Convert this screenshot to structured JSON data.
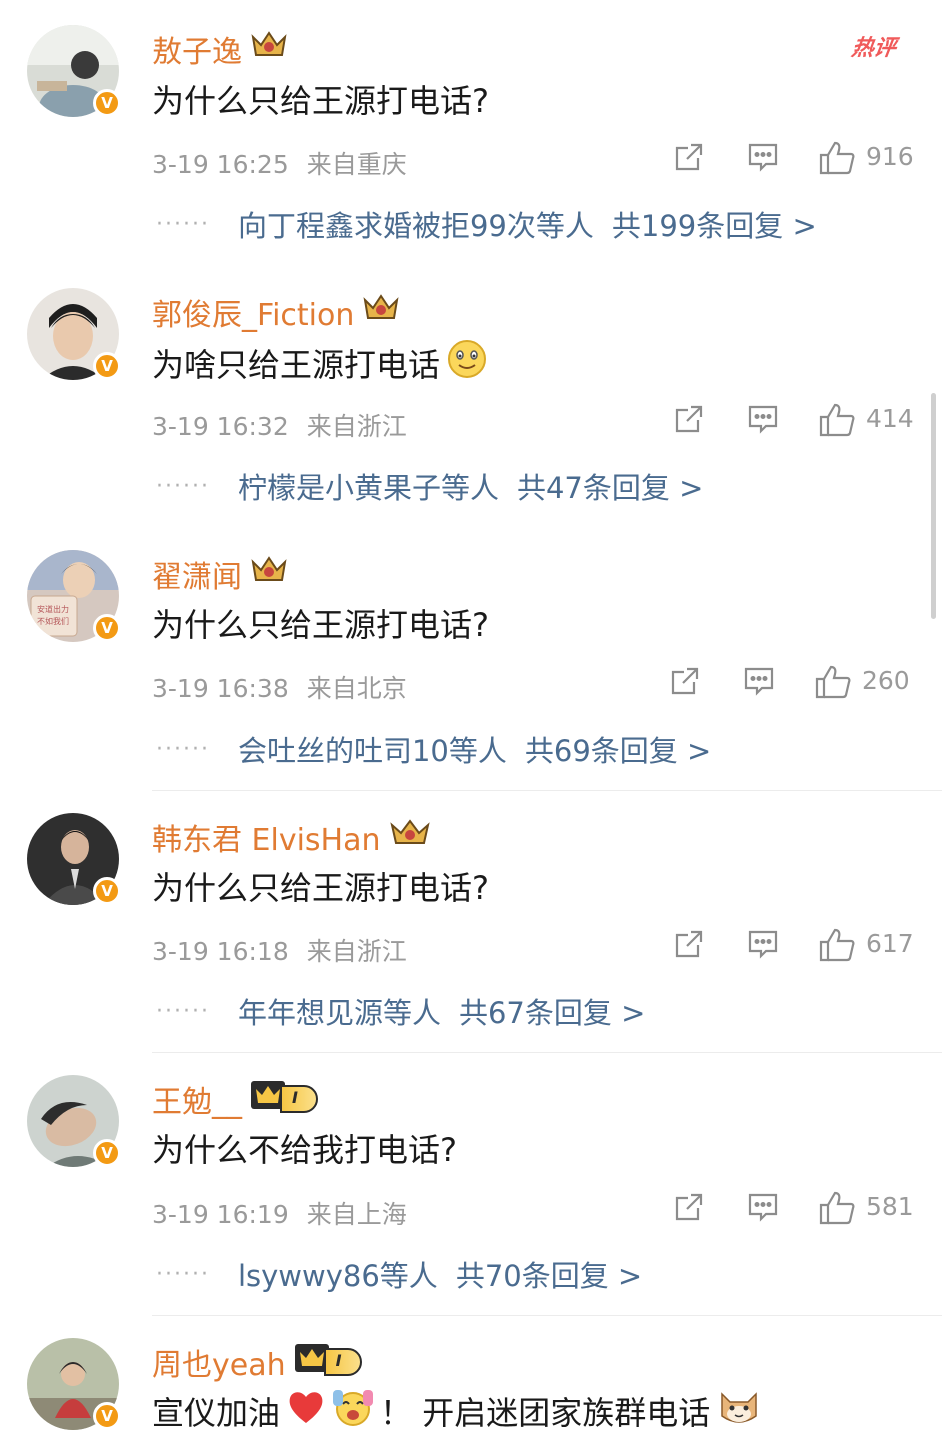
{
  "hot_tag": "热评",
  "comments": [
    {
      "username": "敖子逸",
      "text": "为什么只给王源打电话?",
      "time": "3-19 16:25",
      "location": "来自重庆",
      "likes": "916",
      "reply_users": "向丁程鑫求婚被拒99次等人",
      "reply_count": "共199条回复 >"
    },
    {
      "username": "郭俊辰_Fiction",
      "text": "为啥只给王源打电话",
      "time": "3-19 16:32",
      "location": "来自浙江",
      "likes": "414",
      "reply_users": "柠檬是小黄果子等人",
      "reply_count": "共47条回复 >"
    },
    {
      "username": "翟潇闻",
      "text": "为什么只给王源打电话?",
      "time": "3-19 16:38",
      "location": "来自北京",
      "likes": "260",
      "reply_users": "会吐丝的吐司10等人",
      "reply_count": "共69条回复 >"
    },
    {
      "username": "韩东君 ElvisHan",
      "text": "为什么只给王源打电话?",
      "time": "3-19 16:18",
      "location": "来自浙江",
      "likes": "617",
      "reply_users": "年年想见源等人",
      "reply_count": "共67条回复 >"
    },
    {
      "username": "王勉__",
      "level": "I",
      "text": "为什么不给我打电话?",
      "time": "3-19 16:19",
      "location": "来自上海",
      "likes": "581",
      "reply_users": "lsywwy86等人",
      "reply_count": "共70条回复 >"
    },
    {
      "username": "周也yeah",
      "level": "I",
      "text_part1": "宣仪加油",
      "text_part2": "！ 开启迷团家族群电话"
    }
  ],
  "icons": {
    "share": "share-icon",
    "comment": "comment-icon",
    "like": "thumbs-up-icon",
    "verified": "verified-v-badge",
    "crown": "crown-icon"
  },
  "colors": {
    "username": "#e07b33",
    "link": "#4a6b8f",
    "meta": "#9a9a9a",
    "verified": "#f39a14",
    "hot": "#f05a5a"
  }
}
